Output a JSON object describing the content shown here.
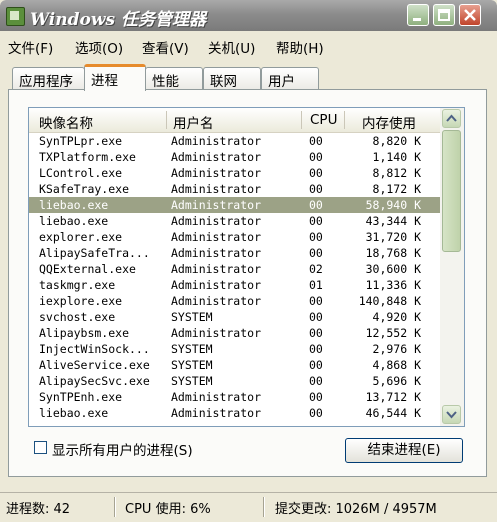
{
  "window": {
    "title": "Windows 任务管理器",
    "buttons": {
      "minimize_icon": "minimize-icon",
      "maximize_icon": "maximize-icon",
      "close_icon": "close-icon"
    }
  },
  "menu": [
    {
      "label": "文件(F)"
    },
    {
      "label": "选项(O)"
    },
    {
      "label": "查看(V)"
    },
    {
      "label": "关机(U)"
    },
    {
      "label": "帮助(H)"
    }
  ],
  "tabs": [
    {
      "label": "应用程序",
      "active": false
    },
    {
      "label": "进程",
      "active": true
    },
    {
      "label": "性能",
      "active": false
    },
    {
      "label": "联网",
      "active": false
    },
    {
      "label": "用户",
      "active": false
    }
  ],
  "process_table": {
    "columns": [
      "映像名称",
      "用户名",
      "CPU",
      "内存使用"
    ],
    "selected_index": 4,
    "rows": [
      {
        "name": "SynTPLpr.exe",
        "user": "Administrator",
        "cpu": "00",
        "mem": "8,820 K"
      },
      {
        "name": "TXPlatform.exe",
        "user": "Administrator",
        "cpu": "00",
        "mem": "1,140 K"
      },
      {
        "name": "LControl.exe",
        "user": "Administrator",
        "cpu": "00",
        "mem": "8,812 K"
      },
      {
        "name": "KSafeTray.exe",
        "user": "Administrator",
        "cpu": "00",
        "mem": "8,172 K"
      },
      {
        "name": "liebao.exe",
        "user": "Administrator",
        "cpu": "00",
        "mem": "58,940 K"
      },
      {
        "name": "liebao.exe",
        "user": "Administrator",
        "cpu": "00",
        "mem": "43,344 K"
      },
      {
        "name": "explorer.exe",
        "user": "Administrator",
        "cpu": "00",
        "mem": "31,720 K"
      },
      {
        "name": "AlipaySafeTra...",
        "user": "Administrator",
        "cpu": "00",
        "mem": "18,768 K"
      },
      {
        "name": "QQExternal.exe",
        "user": "Administrator",
        "cpu": "02",
        "mem": "30,600 K"
      },
      {
        "name": "taskmgr.exe",
        "user": "Administrator",
        "cpu": "01",
        "mem": "11,336 K"
      },
      {
        "name": "iexplore.exe",
        "user": "Administrator",
        "cpu": "00",
        "mem": "140,848 K"
      },
      {
        "name": "svchost.exe",
        "user": "SYSTEM",
        "cpu": "00",
        "mem": "4,920 K"
      },
      {
        "name": "Alipaybsm.exe",
        "user": "Administrator",
        "cpu": "00",
        "mem": "12,552 K"
      },
      {
        "name": "InjectWinSock...",
        "user": "SYSTEM",
        "cpu": "00",
        "mem": "2,976 K"
      },
      {
        "name": "AliveService.exe",
        "user": "SYSTEM",
        "cpu": "00",
        "mem": "4,868 K"
      },
      {
        "name": "AlipaySecSvc.exe",
        "user": "SYSTEM",
        "cpu": "00",
        "mem": "5,696 K"
      },
      {
        "name": "SynTPEnh.exe",
        "user": "Administrator",
        "cpu": "00",
        "mem": "13,712 K"
      },
      {
        "name": "liebao.exe",
        "user": "Administrator",
        "cpu": "00",
        "mem": "46,544 K"
      }
    ]
  },
  "show_all_users": {
    "label": "显示所有用户的进程(S)",
    "checked": false
  },
  "end_process_button": "结束进程(E)",
  "status": {
    "processes": "进程数: 42",
    "cpu": "CPU 使用: 6%",
    "commit": "提交更改: 1026M / 4957M"
  },
  "colors": {
    "titlebar": "#8c8c8c",
    "selection": "#9ca286",
    "tab_highlight": "#e68b2c"
  }
}
